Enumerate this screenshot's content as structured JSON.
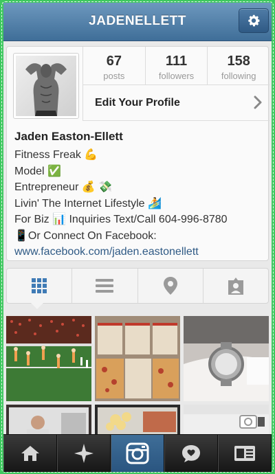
{
  "header": {
    "username": "JADENELLETT",
    "settings_icon": "gear-icon"
  },
  "profile": {
    "stats": [
      {
        "value": "67",
        "label": "posts"
      },
      {
        "value": "111",
        "label": "followers"
      },
      {
        "value": "158",
        "label": "following"
      }
    ],
    "edit_label": "Edit Your Profile",
    "name": "Jaden Easton-Ellett",
    "bio_lines": [
      "Fitness Freak 💪",
      "Model ✅",
      "Entrepreneur 💰 💸",
      "Livin' The Internet Lifestyle 🏄",
      "For Biz 📊  Inquiries Text/Call 604-996-8780",
      "📱Or Connect On Facebook:"
    ],
    "link": "www.facebook.com/jaden.eastonellett"
  },
  "tabs": [
    {
      "name": "grid-view",
      "icon": "grid-icon",
      "active": true
    },
    {
      "name": "list-view",
      "icon": "list-icon",
      "active": false
    },
    {
      "name": "map-view",
      "icon": "location-pin-icon",
      "active": false
    },
    {
      "name": "tagged-view",
      "icon": "tagged-person-icon",
      "active": false
    }
  ],
  "bottom_nav": [
    {
      "name": "home",
      "icon": "home-icon",
      "active": false
    },
    {
      "name": "explore",
      "icon": "explore-star-icon",
      "active": false
    },
    {
      "name": "camera",
      "icon": "camera-icon",
      "active": true
    },
    {
      "name": "news",
      "icon": "heart-bubble-icon",
      "active": false
    },
    {
      "name": "profile",
      "icon": "profile-card-icon",
      "active": false
    }
  ],
  "colors": {
    "accent": "#3f6e98",
    "link": "#2f5a85",
    "frame": "#3ec85f"
  }
}
